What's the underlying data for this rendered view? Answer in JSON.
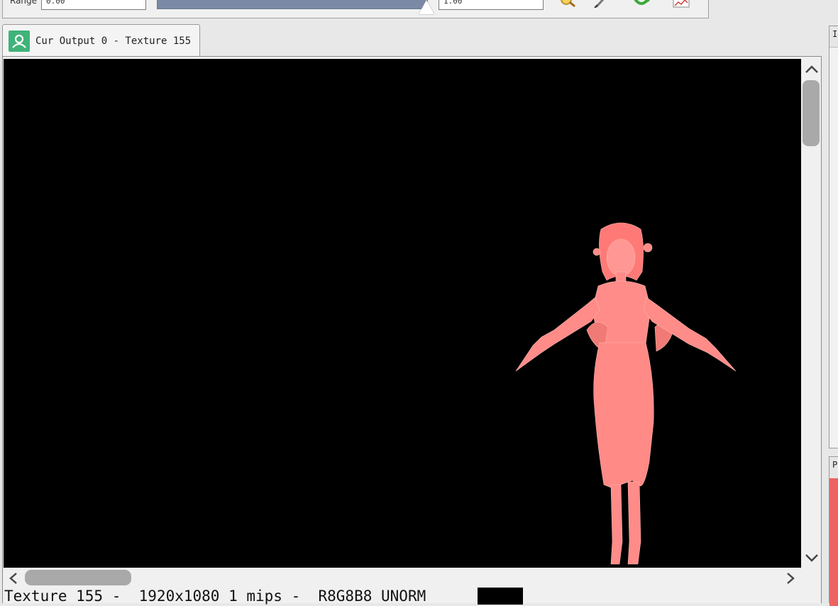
{
  "toolbar": {
    "range_label": "Range",
    "range_min": "0.00",
    "range_max": "1.00",
    "icons": [
      "zoom-icon",
      "pipette-icon",
      "refresh-icon",
      "histogram-icon"
    ]
  },
  "tab": {
    "title": "Cur Output 0 - Texture 155",
    "icon": "texture-output-icon",
    "accent": "#3fb37a"
  },
  "viewer": {
    "background": "#000000",
    "model_color": "#ff8c88"
  },
  "status": {
    "text": "Texture 155 -  1920x1080 1 mips -  R8G8B8 UNORM"
  },
  "side_panels": {
    "top_header": "I",
    "bottom_header": "P",
    "bottom_color": "#ee6262"
  }
}
